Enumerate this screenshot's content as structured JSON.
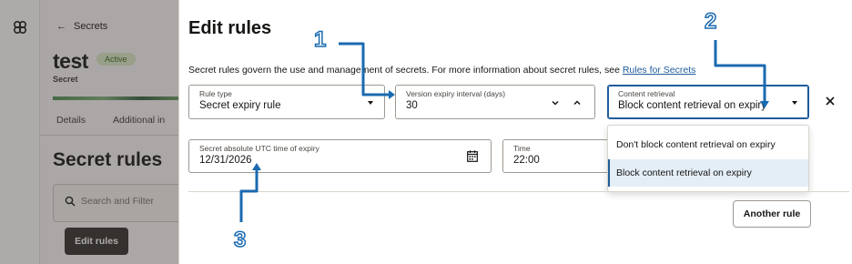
{
  "background": {
    "back_link": "Secrets",
    "resource_name": "test",
    "status_badge": "Active",
    "resource_type": "Secret",
    "tabs": [
      "Details",
      "Additional in"
    ],
    "section_title": "Secret rules",
    "search_placeholder": "Search and Filter",
    "edit_rules_button": "Edit rules"
  },
  "panel": {
    "title": "Edit rules",
    "description": "Secret rules govern the use and management of secrets. For more information about secret rules, see ",
    "description_link": "Rules for Secrets",
    "rule_type": {
      "label": "Rule type",
      "value": "Secret expiry rule"
    },
    "version_expiry": {
      "label": "Version expiry interval (days)",
      "value": "30"
    },
    "content_retrieval": {
      "label": "Content retrieval",
      "value": "Block content retrieval on expiry",
      "options": [
        "Don't block content retrieval on expiry",
        "Block content retrieval on expiry"
      ],
      "selected_index": 1
    },
    "absolute_time": {
      "label": "Secret absolute UTC time of expiry",
      "value": "12/31/2026"
    },
    "time": {
      "label": "Time",
      "value": "22:00"
    },
    "another_rule_button": "Another rule"
  },
  "callouts": [
    "1",
    "2",
    "3"
  ],
  "colors": {
    "accent": "#1f5c9c",
    "callout": "#1a6ab0",
    "primary_button": "#312d2a",
    "active_badge": "#dbebc8"
  },
  "icons": [
    "oracle-logo-icon",
    "back-arrow-icon",
    "search-icon",
    "chevron-down-icon",
    "chevron-up-icon",
    "close-icon",
    "calendar-icon"
  ]
}
